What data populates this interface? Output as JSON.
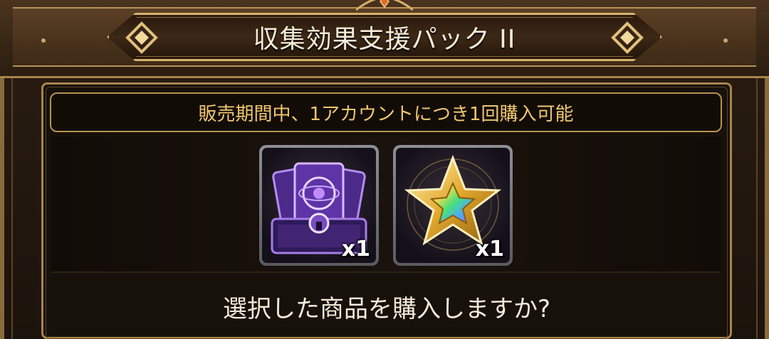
{
  "dialog": {
    "title": "収集効果支援パック II",
    "notice": "販売期間中、1アカウントにつき1回購入可能",
    "question": "選択した商品を購入しますか?"
  },
  "items": [
    {
      "icon": "purple-card-chest-icon",
      "quantity": "x1"
    },
    {
      "icon": "gold-rainbow-star-icon",
      "quantity": "x1"
    }
  ],
  "colors": {
    "frame_gold": "#d6b26a",
    "notice_text": "#f0c66f",
    "panel_bg": "#17110b",
    "title_text": "#f7ecd6"
  }
}
